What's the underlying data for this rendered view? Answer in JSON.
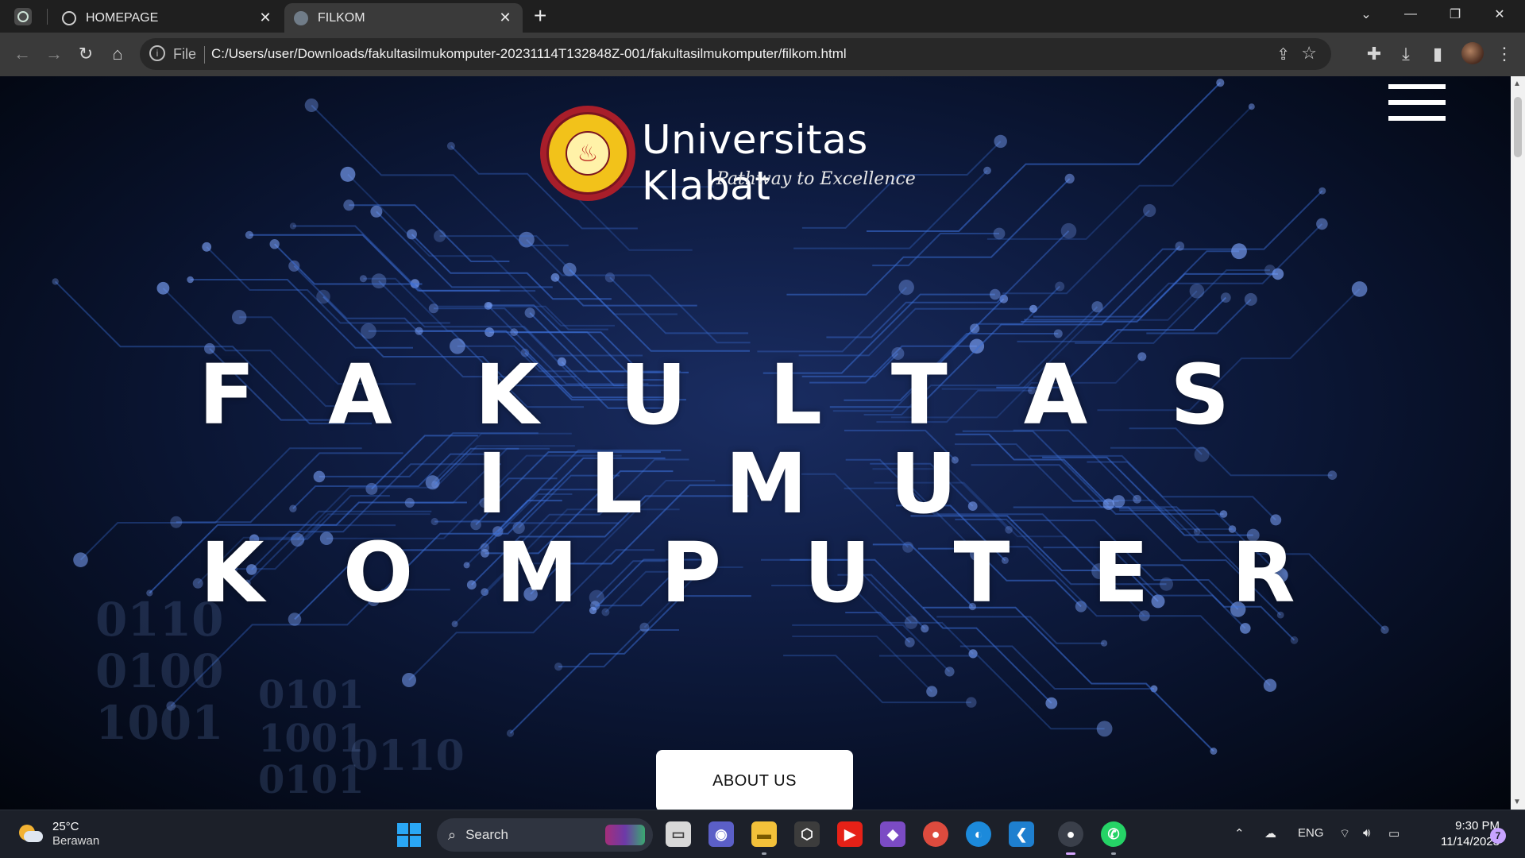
{
  "browser": {
    "tabs": [
      {
        "title": "HOMEPAGE",
        "active": false
      },
      {
        "title": "FILKOM",
        "active": true
      }
    ],
    "new_tab_symbol": "+",
    "address": {
      "scheme_label": "File",
      "url": "C:/Users/user/Downloads/fakultasilmukomputer-20231114T132848Z-001/fakultasilmukomputer/filkom.html"
    }
  },
  "page": {
    "brand": "Universitas Klabat",
    "tagline": "Pathway to Excellence",
    "seal_text": "UNIVERSITAS KLABAT",
    "hero": {
      "line1": "FAKULTAS",
      "line2": "ILMU",
      "line3": "KOMPUTER"
    },
    "about_button": "ABOUT US",
    "binary_digits": [
      "0110",
      "0100",
      "1001",
      "0101",
      "1001",
      "0101",
      "0110"
    ]
  },
  "taskbar": {
    "weather": {
      "temp": "25°C",
      "condition": "Berawan"
    },
    "search_label": "Search",
    "tray": {
      "language": "ENG"
    },
    "clock": {
      "time": "9:30 PM",
      "date": "11/14/2023"
    },
    "notification_count": "7"
  },
  "colors": {
    "page_background": "#0f1d44",
    "circuit_glow": "#3b6fd8",
    "seal_red": "#a81e2a",
    "seal_yellow": "#f2c21a"
  }
}
